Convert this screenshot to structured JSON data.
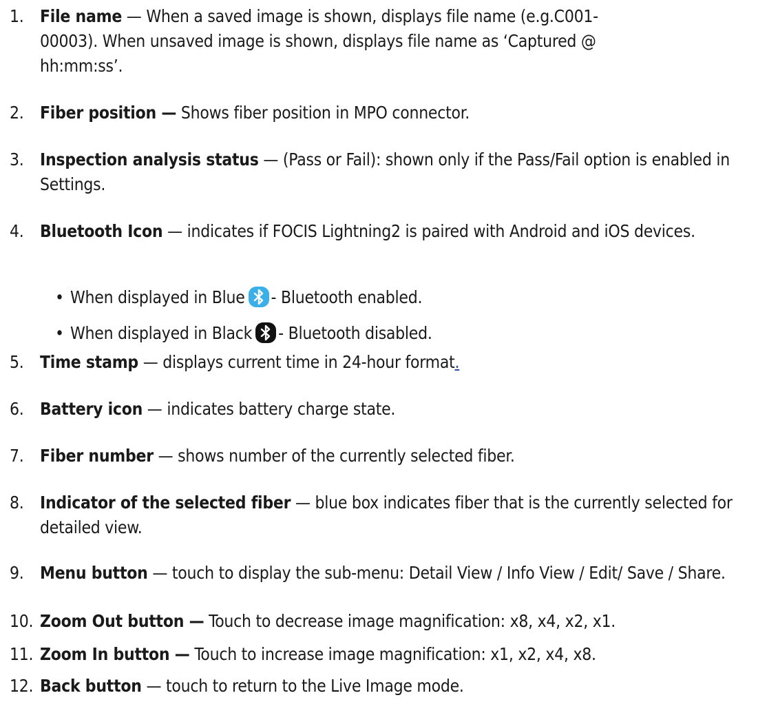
{
  "items": [
    {
      "num": "1.",
      "term": "File name",
      "text": " — When a saved image is shown, displays file name (e.g.C001-00003). When unsaved image is shown, displays file name as ‘Captured @ hh:mm:ss’."
    },
    {
      "num": "2.",
      "term": "Fiber position —",
      "text": " Shows fiber position in MPO connector."
    },
    {
      "num": "3.",
      "term": "Inspection analysis status",
      "text": " — (Pass or Fail): shown only if the Pass/Fail option is enabled in Settings."
    },
    {
      "num": "4.",
      "term": "Bluetooth Icon",
      "text": " — indicates if FOCIS Lightning2 is paired with Android and iOS devices."
    },
    {
      "num": "5.",
      "term": "Time stamp",
      "text": " — displays current time in 24-hour format",
      "link": "."
    },
    {
      "num": "6.",
      "term": "Battery icon",
      "text": " — indicates battery charge state."
    },
    {
      "num": "7.",
      "term": "Fiber number",
      "text": " — shows number of the currently selected fiber."
    },
    {
      "num": "8.",
      "term": "Indicator of the selected fiber",
      "text": " — blue box indicates fiber that is the currently selected for detailed view."
    },
    {
      "num": "9.",
      "term": "Menu button",
      "text": " — touch to display the sub-menu: Detail View / Info View / Edit/ Save / Share."
    },
    {
      "num": "10.",
      "term": "Zoom Out button —",
      "text": " Touch to decrease image magnification: x8, x4, x2, x1."
    },
    {
      "num": "11.",
      "term": "Zoom In button —",
      "text": " Touch to increase image magnification: x1, x2, x4, x8."
    },
    {
      "num": "12.",
      "term": "Back button",
      "text": " — touch to return to the Live Image mode."
    }
  ],
  "bluetooth_bullets": [
    {
      "before": "When displayed in Blue",
      "after": "- Bluetooth enabled.",
      "icon": "bluetooth-blue-icon",
      "color": "#3bb0e8"
    },
    {
      "before": "When displayed in Black",
      "after": "- Bluetooth disabled.",
      "icon": "bluetooth-black-icon",
      "color": "#111111"
    }
  ],
  "bullet_glyph": "•"
}
